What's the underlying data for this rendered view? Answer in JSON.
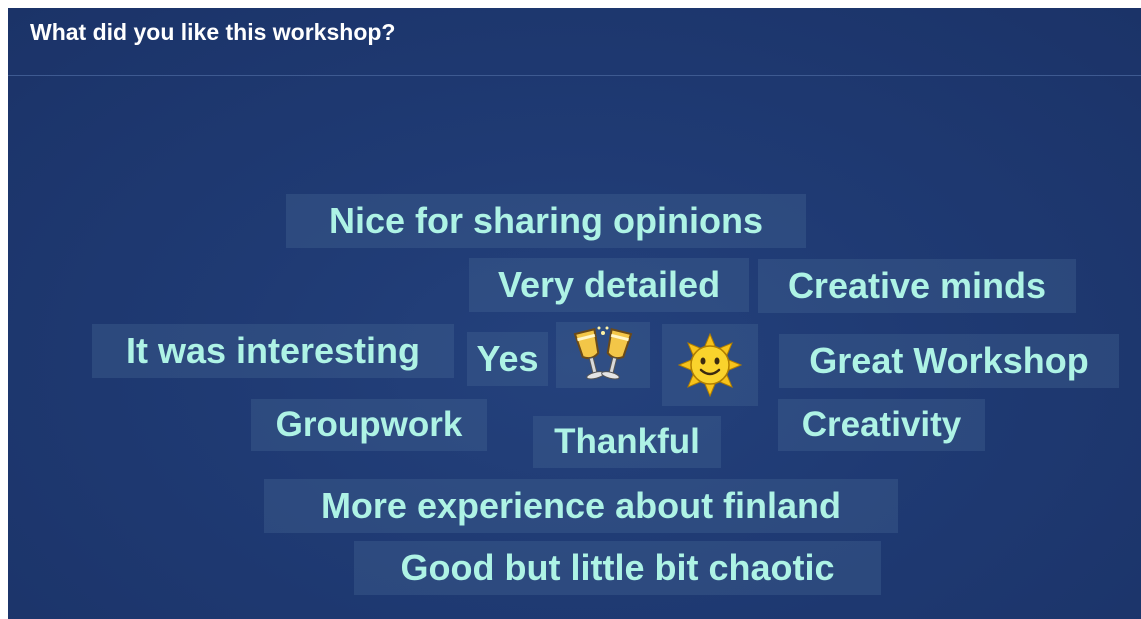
{
  "question": "What did you like this workshop?",
  "colors": {
    "background": "#1f3a73",
    "word_text": "#aef3e5",
    "header_text": "#ffffff"
  },
  "responses": [
    "Nice for sharing opinions",
    "Very detailed",
    "Creative minds",
    "It was interesting",
    "Yes",
    "Great Workshop",
    "Groupwork",
    "Thankful",
    "Creativity",
    "More experience about finland",
    "Good but little bit chaotic"
  ],
  "emoji_responses": [
    "clinking-glasses-icon",
    "sun-with-face-icon"
  ]
}
